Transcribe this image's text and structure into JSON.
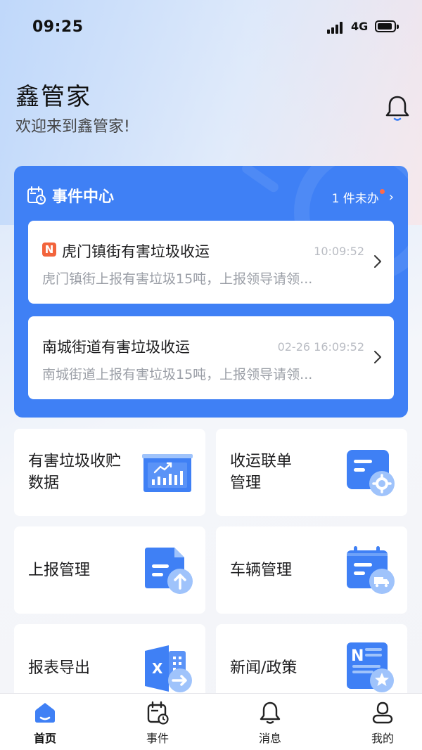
{
  "status_bar": {
    "time": "09:25",
    "network": "4G"
  },
  "header": {
    "title": "鑫管家",
    "subtitle": "欢迎来到鑫管家!"
  },
  "event_center": {
    "title": "事件中心",
    "pending_text": "1 件未办",
    "items": [
      {
        "badge": "N",
        "title": "虎门镇街有害垃圾收运",
        "time": "10:09:52",
        "desc": "虎门镇街上报有害垃圾15吨，上报领导请领..."
      },
      {
        "title": "南城街道有害垃圾收运",
        "time": "02-26 16:09:52",
        "desc": "南城街道上报有害垃圾15吨，上报领导请领..."
      }
    ]
  },
  "tiles": [
    {
      "label_line1": "有害垃圾收贮",
      "label_line2": "数据",
      "icon": "chart-board-icon"
    },
    {
      "label_line1": "收运联单",
      "label_line2": "管理",
      "icon": "settings-card-icon"
    },
    {
      "label_line1": "上报管理",
      "icon": "upload-doc-icon"
    },
    {
      "label_line1": "车辆管理",
      "icon": "truck-calendar-icon"
    },
    {
      "label_line1": "报表导出",
      "icon": "excel-export-icon"
    },
    {
      "label_line1": "新闻/政策",
      "icon": "news-star-icon"
    }
  ],
  "tab_bar": {
    "tabs": [
      {
        "label": "首页",
        "icon": "home-icon",
        "active": true
      },
      {
        "label": "事件",
        "icon": "calendar-icon"
      },
      {
        "label": "消息",
        "icon": "bell-icon"
      },
      {
        "label": "我的",
        "icon": "user-icon"
      }
    ]
  },
  "colors": {
    "primary": "#3f80f5",
    "accent_light": "#9fc3fb",
    "badge": "#f2643c"
  }
}
